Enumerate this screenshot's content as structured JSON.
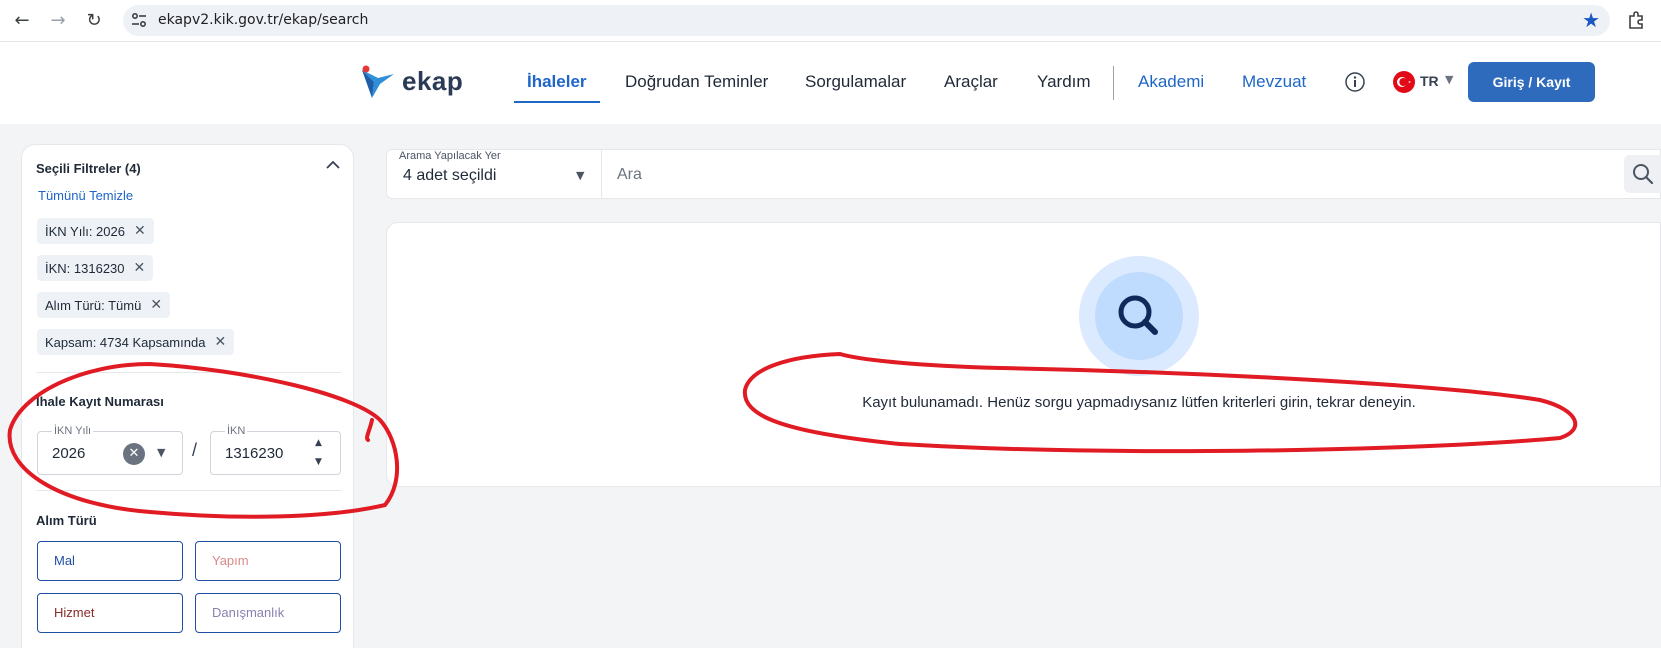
{
  "browser": {
    "url": "ekapv2.kik.gov.tr/ekap/search",
    "back_icon": "arrow-left-icon",
    "forward_icon": "arrow-right-icon",
    "reload_icon": "reload-icon",
    "bookmark_icon": "star-icon"
  },
  "header": {
    "logo_text": "ekap",
    "nav": [
      {
        "label": "İhaleler",
        "active": true
      },
      {
        "label": "Doğrudan Teminler"
      },
      {
        "label": "Sorgulamalar"
      },
      {
        "label": "Araçlar"
      },
      {
        "label": "Yardım"
      },
      {
        "label": "Akademi"
      },
      {
        "label": "Mevzuat"
      }
    ],
    "language": "TR",
    "login_label": "Giriş / Kayıt",
    "accent_color": "#1e66c8"
  },
  "sidebar": {
    "title": "Seçili Filtreler (4)",
    "clear_all": "Tümünü Temizle",
    "chips": [
      "İKN Yılı: 2026",
      "İKN: 1316230",
      "Alım Türü: Tümü",
      "Kapsam: 4734 Kapsamında"
    ],
    "ikn_section": {
      "title": "İhale Kayıt Numarası",
      "year_label": "İKN Yılı",
      "year_value": "2026",
      "separator": "/",
      "number_label": "İKN",
      "number_value": "1316230"
    },
    "type_section": {
      "title": "Alım Türü",
      "options": [
        {
          "label": "Mal",
          "color": "#1e4fa3"
        },
        {
          "label": "Yapım",
          "color": "#d88a8a"
        },
        {
          "label": "Hizmet",
          "color": "#8b2a2a"
        },
        {
          "label": "Danışmanlık",
          "color": "#8a7fb0"
        }
      ]
    }
  },
  "search": {
    "scope_label": "Arama Yapılacak Yer",
    "scope_value": "4 adet seçildi",
    "placeholder": "Ara"
  },
  "results": {
    "empty_message": "Kayıt bulunamadı. Henüz sorgu yapmadıysanız lütfen kriterleri girin, tekrar deneyin."
  },
  "annotation_color": "#e01b24"
}
